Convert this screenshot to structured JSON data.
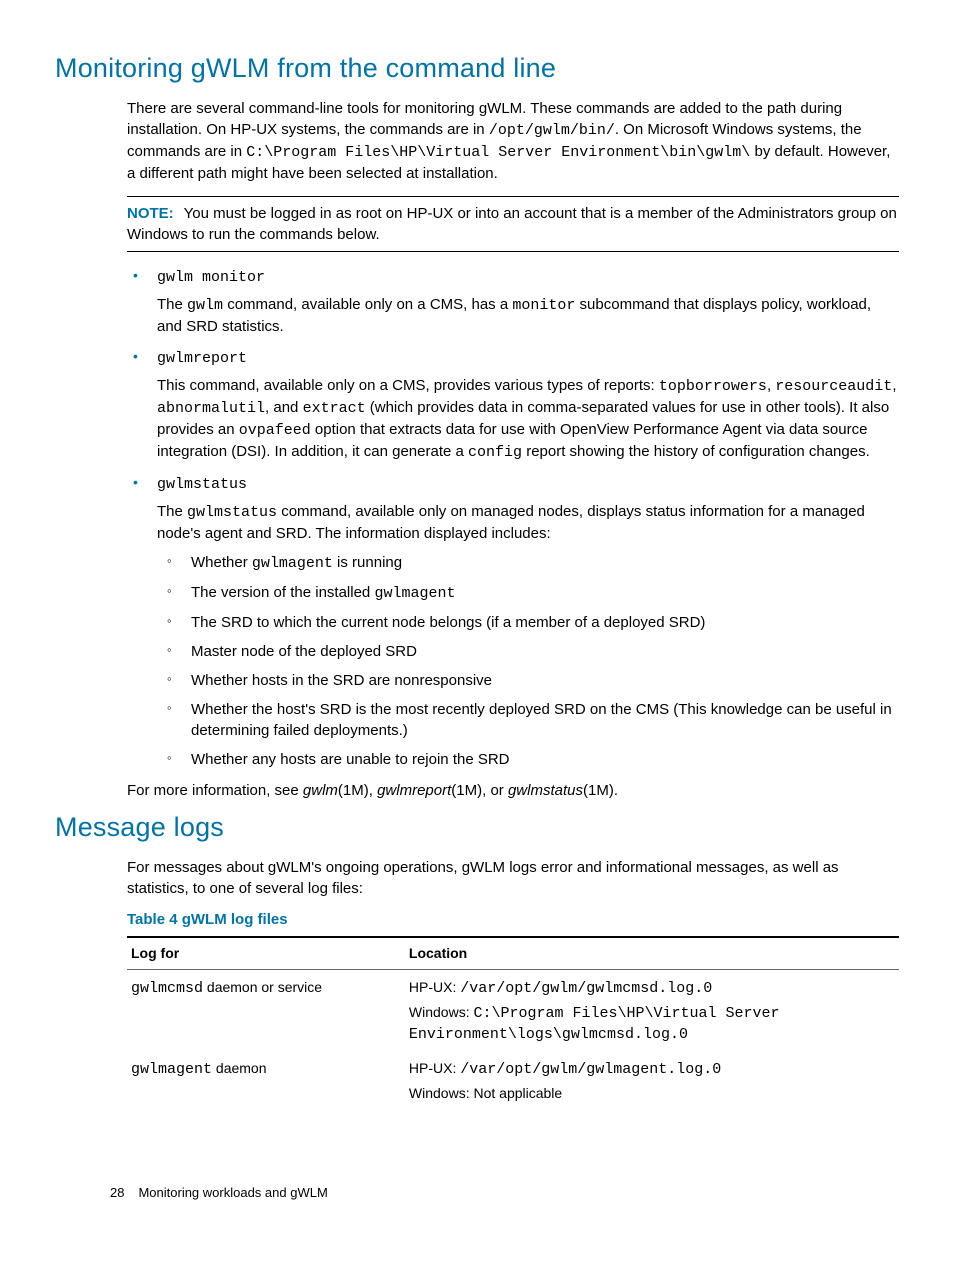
{
  "section1": {
    "heading": "Monitoring gWLM from the command line",
    "intro_pre": "There are several command-line tools for monitoring gWLM. These commands are added to the path during installation. On HP-UX systems, the commands are in ",
    "path_hpux": "/opt/gwlm/bin/",
    "intro_mid": ". On Microsoft Windows systems, the commands are in ",
    "path_win": "C:\\Program Files\\HP\\Virtual Server Environment\\bin\\gwlm\\",
    "intro_post": " by default. However, a different path might have been selected at installation.",
    "note_label": "NOTE:",
    "note_text": "You must be logged in as root on HP-UX or into an account that is a member of the Administrators group on Windows to run the commands below.",
    "item1": {
      "cmd": "gwlm monitor",
      "pre": "The ",
      "c1": "gwlm",
      "mid": " command, available only on a CMS, has a ",
      "c2": "monitor",
      "post": " subcommand that displays policy, workload, and SRD statistics."
    },
    "item2": {
      "cmd": "gwlmreport",
      "pre": "This command, available only on a CMS, provides various types of reports: ",
      "c1": "topborrowers",
      "s1": ", ",
      "c2": "resourceaudit",
      "s2": ", ",
      "c3": "abnormalutil",
      "s3": ", and ",
      "c4": "extract",
      "mid": " (which provides data in comma-separated values for use in other tools). It also provides an ",
      "c5": "ovpafeed",
      "mid2": " option that extracts data for use with OpenView Performance Agent via data source integration (DSI). In addition, it can generate a ",
      "c6": "config",
      "post": " report showing the history of configuration changes."
    },
    "item3": {
      "cmd": "gwlmstatus",
      "pre": "The ",
      "c1": "gwlmstatus",
      "post": " command, available only on managed nodes, displays status information for a managed node's agent and SRD. The information displayed includes:",
      "sub1_pre": "Whether ",
      "sub1_c": "gwlmagent",
      "sub1_post": " is running",
      "sub2_pre": "The version of the installed ",
      "sub2_c": "gwlmagent",
      "sub3": "The SRD to which the current node belongs (if a member of a deployed SRD)",
      "sub4": "Master node of the deployed SRD",
      "sub5": "Whether hosts in the SRD are nonresponsive",
      "sub6": "Whether the host's SRD is the most recently deployed SRD on the CMS (This knowledge can be useful in determining failed deployments.)",
      "sub7": "Whether any hosts are unable to rejoin the SRD"
    },
    "moreinfo_pre": "For more information, see ",
    "man1": "gwlm",
    "man_suffix": "(1M)",
    "sep1": ", ",
    "man2": "gwlmreport",
    "sep2": ", or ",
    "man3": "gwlmstatus",
    "moreinfo_post": "."
  },
  "section2": {
    "heading": "Message logs",
    "intro": "For messages about gWLM's ongoing operations, gWLM logs error and informational messages, as well as statistics, to one of several log files:",
    "table_caption": "Table 4 gWLM log files",
    "th1": "Log for",
    "th2": "Location",
    "row1": {
      "c1_code": "gwlmcmsd",
      "c1_text": " daemon or service",
      "loc1_pre": "HP-UX: ",
      "loc1_code": "/var/opt/gwlm/gwlmcmsd.log.0",
      "loc2_pre": "Windows: ",
      "loc2_code": "C:\\Program Files\\HP\\Virtual Server Environment\\logs\\gwlmcmsd.log.0"
    },
    "row2": {
      "c1_code": "gwlmagent",
      "c1_text": " daemon",
      "loc1_pre": "HP-UX: ",
      "loc1_code": "/var/opt/gwlm/gwlmagent.log.0",
      "loc2": "Windows: Not applicable"
    }
  },
  "footer": {
    "page": "28",
    "title": "Monitoring workloads and gWLM"
  }
}
